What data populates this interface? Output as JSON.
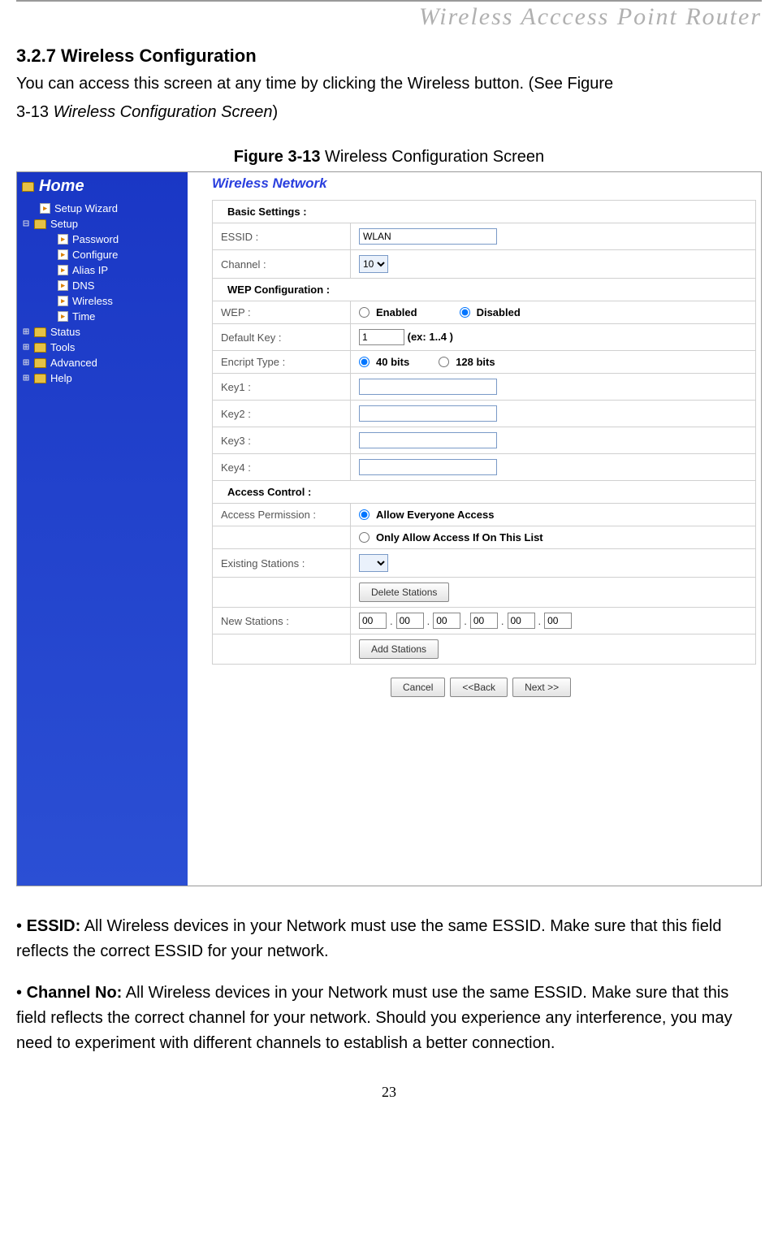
{
  "doc_header": "Wireless  Acccess  Point  Router",
  "section_heading": "3.2.7 Wireless Configuration",
  "intro_line1": "You can access this screen at any time by clicking the Wireless button. (See Figure",
  "intro_line2_prefix": "3-13 ",
  "intro_line2_italic": "Wireless Configuration Screen",
  "intro_line2_suffix": ")",
  "figure_caption_bold": "Figure 3-13",
  "figure_caption_rest": " Wireless Configuration Screen",
  "sidebar": {
    "home": "Home",
    "items": [
      {
        "label": "Setup Wizard",
        "icon": "page",
        "indent": 1,
        "prefix": ""
      },
      {
        "label": "Setup",
        "icon": "folder",
        "indent": 0,
        "prefix": "⊟"
      },
      {
        "label": "Password",
        "icon": "page",
        "indent": 2,
        "prefix": ""
      },
      {
        "label": "Configure",
        "icon": "page",
        "indent": 2,
        "prefix": ""
      },
      {
        "label": "Alias IP",
        "icon": "page",
        "indent": 2,
        "prefix": ""
      },
      {
        "label": "DNS",
        "icon": "page",
        "indent": 2,
        "prefix": ""
      },
      {
        "label": "Wireless",
        "icon": "page",
        "indent": 2,
        "prefix": ""
      },
      {
        "label": "Time",
        "icon": "page",
        "indent": 2,
        "prefix": ""
      },
      {
        "label": "Status",
        "icon": "folder",
        "indent": 0,
        "prefix": "⊞"
      },
      {
        "label": "Tools",
        "icon": "folder",
        "indent": 0,
        "prefix": "⊞"
      },
      {
        "label": "Advanced",
        "icon": "folder",
        "indent": 0,
        "prefix": "⊞"
      },
      {
        "label": "Help",
        "icon": "folder",
        "indent": 0,
        "prefix": "⊞"
      }
    ]
  },
  "panel": {
    "title": "Wireless Network",
    "sections": {
      "basic": "Basic Settings :",
      "wep": "WEP Configuration :",
      "access": "Access Control :"
    },
    "labels": {
      "essid": "ESSID :",
      "channel": "Channel :",
      "wep": "WEP :",
      "default_key": "Default Key :",
      "encript_type": "Encript Type :",
      "key1": "Key1 :",
      "key2": "Key2 :",
      "key3": "Key3 :",
      "key4": "Key4 :",
      "access_permission": "Access Permission :",
      "existing_stations": "Existing Stations :",
      "new_stations": "New Stations :"
    },
    "values": {
      "essid": "WLAN",
      "channel": "10",
      "wep_enabled": "Enabled",
      "wep_disabled": "Disabled",
      "default_key": "1",
      "default_key_hint": "(ex: 1..4 )",
      "bits40": "40 bits",
      "bits128": "128 bits",
      "allow_all": "Allow Everyone Access",
      "only_list": "Only Allow Access If On This List",
      "delete_btn": "Delete Stations",
      "add_btn": "Add Stations",
      "mac": [
        "00",
        "00",
        "00",
        "00",
        "00",
        "00"
      ],
      "sep": ".",
      "cancel": "Cancel",
      "back": "<<Back",
      "next": "Next >>"
    }
  },
  "bullets": {
    "essid_label": "ESSID:",
    "essid_text": " All Wireless devices in your Network must use the same ESSID. Make sure that this field reflects the correct ESSID for your network.",
    "channel_label": "Channel No:",
    "channel_text": " All Wireless devices in your Network must use the same ESSID. Make sure that this field reflects the correct channel for your network. Should you experience any interference, you may need to experiment with different channels to establish a better connection."
  },
  "page_number": "23"
}
